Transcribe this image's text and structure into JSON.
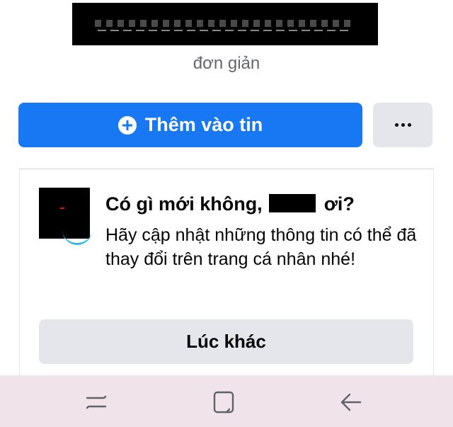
{
  "profile": {
    "bio": "đơn giản"
  },
  "actions": {
    "add_story_label": "Thêm vào tin",
    "add_story_icon": "plus-circle-icon",
    "more_icon": "more-horizontal-icon"
  },
  "prompt": {
    "title_prefix": "Có gì mới không,",
    "title_suffix": "ơi?",
    "body": "Hãy cập nhật những thông tin có thể đã thay đổi trên trang cá nhân nhé!",
    "later_label": "Lúc khác"
  },
  "navbar": {
    "recent_icon": "recent-apps-icon",
    "home_icon": "home-icon",
    "back_icon": "back-icon"
  },
  "colors": {
    "primary": "#1877f2",
    "secondary_button": "#e4e6eb",
    "text": "#050505",
    "muted_text": "#65676b",
    "nav_background": "#f0e4ea"
  }
}
